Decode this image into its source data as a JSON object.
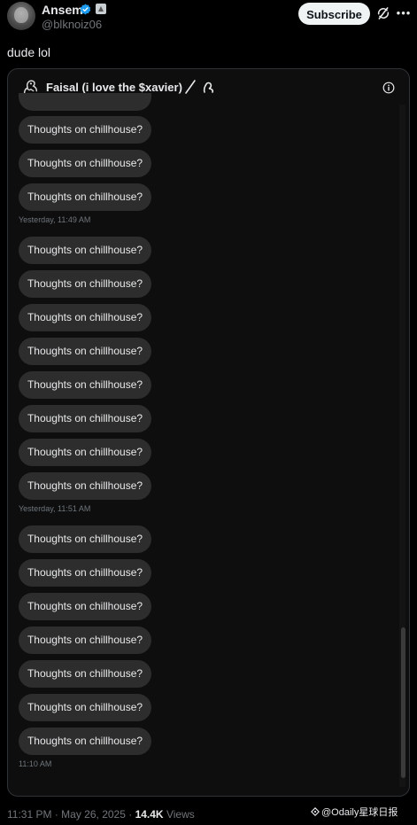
{
  "author": {
    "name": "Ansem",
    "handle": "@blknoiz06"
  },
  "subscribe_label": "Subscribe",
  "tweet_text": "dude lol",
  "dm": {
    "name": "Faisal (i love the $xavier)",
    "groups": [
      {
        "messages": [
          "Thoughts on chillhouse?",
          "Thoughts on chillhouse?",
          "Thoughts on chillhouse?"
        ],
        "timestamp": "Yesterday, 11:49 AM"
      },
      {
        "messages": [
          "Thoughts on chillhouse?",
          "Thoughts on chillhouse?",
          "Thoughts on chillhouse?",
          "Thoughts on chillhouse?",
          "Thoughts on chillhouse?",
          "Thoughts on chillhouse?",
          "Thoughts on chillhouse?",
          "Thoughts on chillhouse?"
        ],
        "timestamp": "Yesterday, 11:51 AM"
      },
      {
        "messages": [
          "Thoughts on chillhouse?",
          "Thoughts on chillhouse?",
          "Thoughts on chillhouse?",
          "Thoughts on chillhouse?",
          "Thoughts on chillhouse?",
          "Thoughts on chillhouse?",
          "Thoughts on chillhouse?"
        ],
        "timestamp": "11:10 AM"
      }
    ]
  },
  "footer": {
    "time": "11:31 PM",
    "separator": "·",
    "date": "May 26, 2025",
    "views_count": "14.4K",
    "views_label": "Views"
  },
  "watermark": "@Odaily星球日报",
  "colors": {
    "background": "#000000",
    "bubble": "#2d2d2d",
    "verified": "#1d9bf0",
    "muted_text": "#71767b"
  }
}
